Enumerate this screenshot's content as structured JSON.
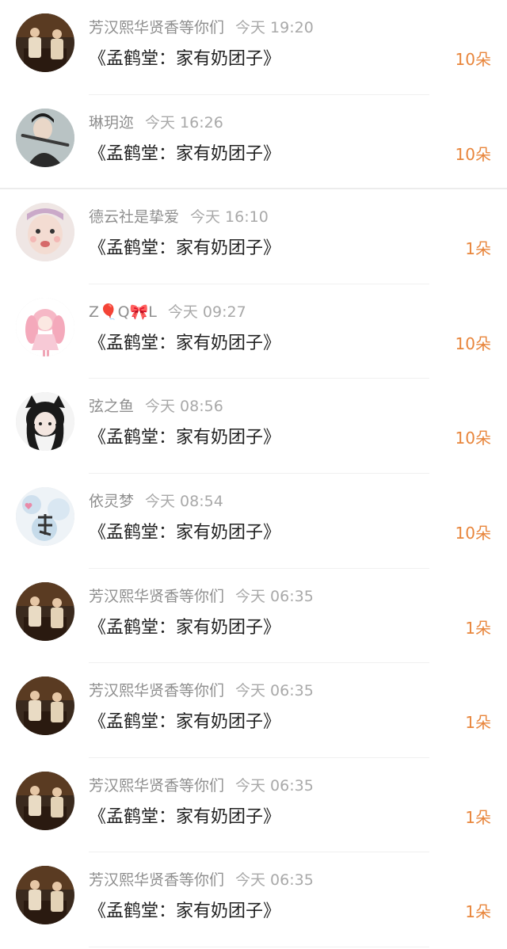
{
  "items": [
    {
      "name": "芳汉熙华贤香等你们",
      "time": "今天 19:20",
      "title": "《孟鹤堂：家有奶团子》",
      "count": "10朵",
      "avatar": "avatar-duo-icon"
    },
    {
      "name": "琳玥迩",
      "time": "今天 16:26",
      "title": "《孟鹤堂：家有奶团子》",
      "count": "10朵",
      "avatar": "avatar-flute-icon"
    },
    {
      "name": "德云社是挚爱",
      "time": "今天 16:10",
      "title": "《孟鹤堂：家有奶团子》",
      "count": "1朵",
      "avatar": "avatar-face-icon"
    },
    {
      "name": "Z🎈Q🎀L",
      "time": "今天 09:27",
      "title": "《孟鹤堂：家有奶团子》",
      "count": "10朵",
      "avatar": "avatar-pink-girl-icon"
    },
    {
      "name": "弦之鱼",
      "time": "今天 08:56",
      "title": "《孟鹤堂：家有奶团子》",
      "count": "10朵",
      "avatar": "avatar-cat-girl-icon"
    },
    {
      "name": "依灵梦",
      "time": "今天 08:54",
      "title": "《孟鹤堂：家有奶团子》",
      "count": "10朵",
      "avatar": "avatar-dream-icon"
    },
    {
      "name": "芳汉熙华贤香等你们",
      "time": "今天 06:35",
      "title": "《孟鹤堂：家有奶团子》",
      "count": "1朵",
      "avatar": "avatar-duo-icon"
    },
    {
      "name": "芳汉熙华贤香等你们",
      "time": "今天 06:35",
      "title": "《孟鹤堂：家有奶团子》",
      "count": "1朵",
      "avatar": "avatar-duo-icon"
    },
    {
      "name": "芳汉熙华贤香等你们",
      "time": "今天 06:35",
      "title": "《孟鹤堂：家有奶团子》",
      "count": "1朵",
      "avatar": "avatar-duo-icon"
    },
    {
      "name": "芳汉熙华贤香等你们",
      "time": "今天 06:35",
      "title": "《孟鹤堂：家有奶团子》",
      "count": "1朵",
      "avatar": "avatar-duo-icon"
    }
  ],
  "colors": {
    "count": "#e8853b",
    "name": "#8f8f8f",
    "time": "#a9a9a9",
    "title": "#222222"
  }
}
